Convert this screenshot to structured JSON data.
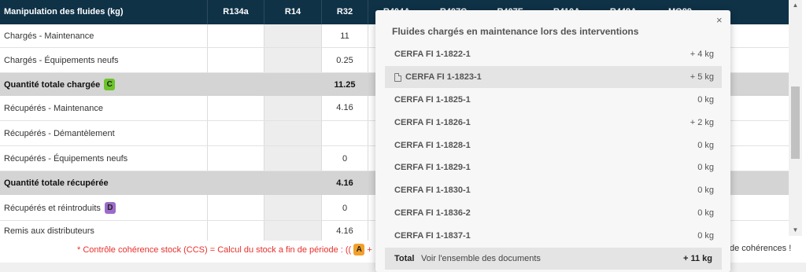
{
  "table": {
    "header": {
      "title": "Manipulation des fluides (kg)",
      "columns": [
        "R134a",
        "R14",
        "R32",
        "R404A",
        "R407C",
        "R407F",
        "R410A",
        "R449A",
        "MO89"
      ]
    },
    "rows": [
      {
        "label": "Chargés - Maintenance",
        "r32": "11",
        "total": false,
        "badge": ""
      },
      {
        "label": "Chargés - Équipements neufs",
        "r32": "0.25",
        "total": false,
        "badge": ""
      },
      {
        "label": "Quantité totale chargée",
        "r32": "11.25",
        "total": true,
        "badge": "C"
      },
      {
        "label": "Récupérés - Maintenance",
        "r32": "4.16",
        "total": false,
        "badge": ""
      },
      {
        "label": "Récupérés - Démantèlement",
        "r32": "",
        "total": false,
        "badge": ""
      },
      {
        "label": "Récupérés - Équipements neufs",
        "r32": "0",
        "total": false,
        "badge": ""
      },
      {
        "label": "Quantité totale récupérée",
        "r32": "4.16",
        "total": true,
        "badge": ""
      },
      {
        "label": "Récupérés et réintroduits",
        "r32": "0",
        "total": false,
        "badge": "D"
      },
      {
        "label": "Remis aux distributeurs",
        "r32": "4.16",
        "total": false,
        "badge": ""
      }
    ]
  },
  "note": {
    "text": "* Contrôle cohérence stock (CCS) = Calcul du stock a fin de période : ((",
    "badge_a": "A",
    "plus": "+",
    "tail": "de cohérences !"
  },
  "popover": {
    "title": "Fluides chargés en maintenance lors des interventions",
    "close": "×",
    "items": [
      {
        "name": "CERFA FI 1-1822-1",
        "qty": "+  4 kg"
      },
      {
        "name": "CERFA FI 1-1823-1",
        "qty": "+  5 kg"
      },
      {
        "name": "CERFA FI 1-1825-1",
        "qty": "0 kg"
      },
      {
        "name": "CERFA FI 1-1826-1",
        "qty": "+  2 kg"
      },
      {
        "name": "CERFA FI 1-1828-1",
        "qty": "0 kg"
      },
      {
        "name": "CERFA FI 1-1829-1",
        "qty": "0 kg"
      },
      {
        "name": "CERFA FI 1-1830-1",
        "qty": "0 kg"
      },
      {
        "name": "CERFA FI 1-1836-2",
        "qty": "0 kg"
      },
      {
        "name": "CERFA FI 1-1837-1",
        "qty": "0 kg"
      }
    ],
    "footer": {
      "label": "Total",
      "link": "Voir l'ensemble des documents",
      "total": "+  11 kg"
    }
  },
  "colors": {
    "header_bg": "#0f3247",
    "badge_c": "#6cc42a",
    "badge_d": "#9b6bc9",
    "badge_a": "#f2a02a",
    "note_red": "#e8302b"
  }
}
